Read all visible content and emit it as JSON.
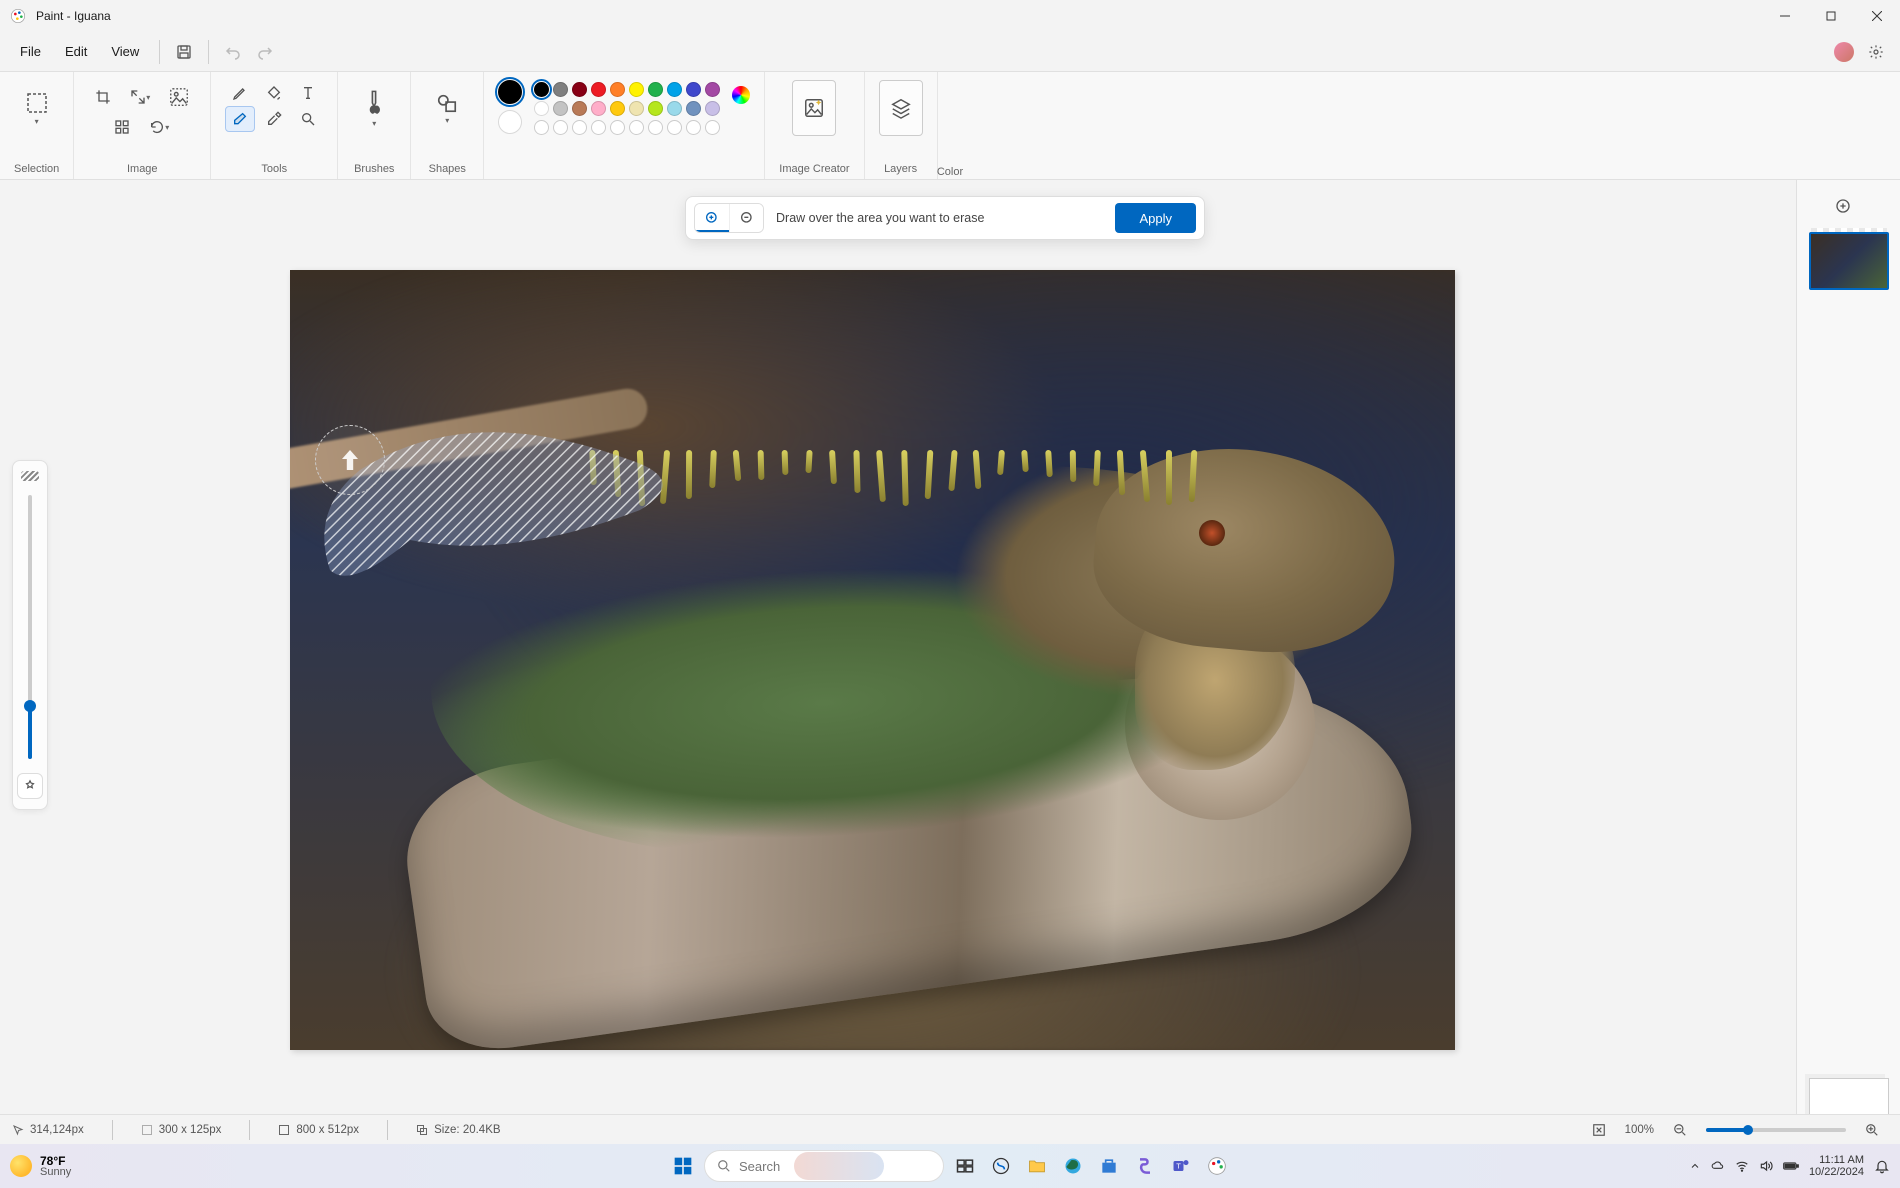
{
  "window": {
    "title": "Paint - Iguana"
  },
  "menus": {
    "file": "File",
    "edit": "Edit",
    "view": "View"
  },
  "ribbon": {
    "selection": "Selection",
    "image": "Image",
    "tools": "Tools",
    "brushes": "Brushes",
    "shapes": "Shapes",
    "color": "Color",
    "image_creator": "Image Creator",
    "layers": "Layers"
  },
  "palette": {
    "primary": "#000000",
    "secondary": "#ffffff",
    "row1": [
      "#000000",
      "#7f7f7f",
      "#880015",
      "#ed1c24",
      "#ff7f27",
      "#fff200",
      "#22b14c",
      "#00a2e8",
      "#3f48cc",
      "#a349a4"
    ],
    "row2": [
      "#ffffff",
      "#c3c3c3",
      "#b97a57",
      "#ffaec9",
      "#ffc90e",
      "#efe4b0",
      "#b5e61d",
      "#99d9ea",
      "#7092be",
      "#c8bfe7"
    ]
  },
  "erase_bar": {
    "hint": "Draw over the area you want to erase",
    "apply": "Apply"
  },
  "status": {
    "cursor": "314,124px",
    "selection": "300  x  125px",
    "canvas": "800  x  512px",
    "filesize": "Size: 20.4KB",
    "zoom": "100%"
  },
  "taskbar": {
    "temp": "78°F",
    "weather": "Sunny",
    "search": "Search",
    "time": "11:11 AM",
    "date": "10/22/2024"
  }
}
